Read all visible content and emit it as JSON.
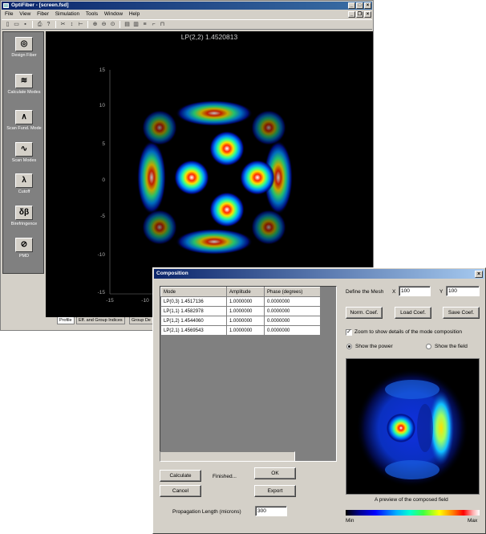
{
  "main_window": {
    "title": "OptiFiber - [screen.fsd]",
    "menu": [
      "File",
      "View",
      "Fiber",
      "Simulation",
      "Tools",
      "Window",
      "Help"
    ],
    "sidebar": [
      {
        "label": "Design Fiber",
        "icon": "design-fiber-icon",
        "glyph": "◎"
      },
      {
        "label": "Calculate Modes",
        "icon": "calculate-modes-icon",
        "glyph": "≋"
      },
      {
        "label": "Scan Fund. Mode",
        "icon": "scan-fund-mode-icon",
        "glyph": "∧"
      },
      {
        "label": "Scan Modes",
        "icon": "scan-modes-icon",
        "glyph": "∿"
      },
      {
        "label": "Cutoff",
        "icon": "cutoff-icon",
        "glyph": "λ"
      },
      {
        "label": "Birefringence",
        "icon": "birefringence-icon",
        "glyph": "δβ"
      },
      {
        "label": "PMD",
        "icon": "pmd-icon",
        "glyph": "⊘"
      }
    ],
    "plot": {
      "title": "LP(2,2)  1.4520813",
      "y_ticks": [
        "15",
        "10",
        "5",
        "0",
        "-5",
        "-10",
        "-15"
      ],
      "x_ticks": [
        "-15",
        "-10"
      ]
    },
    "tabs": [
      "Profile",
      "Eff. and Group Indices",
      "Group De"
    ]
  },
  "composition_dialog": {
    "title": "Composition",
    "close_glyph": "×",
    "table": {
      "headers": [
        "Mode",
        "Amplitude",
        "Phase (degrees)"
      ],
      "rows": [
        [
          "LP(0,3)  1.4517136",
          "1.0000000",
          "0.0000000"
        ],
        [
          "LP(1,1)  1.4582978",
          "1.0000000",
          "0.0000000"
        ],
        [
          "LP(1,2)  1.4544060",
          "1.0000000",
          "0.0000000"
        ],
        [
          "LP(2,1)  1.4569543",
          "1.0000000",
          "0.0000000"
        ]
      ]
    },
    "mesh": {
      "label": "Define the Mesh",
      "x_label": "X",
      "x_value": "100",
      "y_label": "Y",
      "y_value": "100"
    },
    "buttons": {
      "norm": "Norm. Coef.",
      "load": "Load Coef.",
      "save": "Save Coef.",
      "calculate": "Calculate",
      "cancel": "Cancel",
      "ok": "OK",
      "export": "Export"
    },
    "zoom_checkbox": {
      "label": "Zoom to show details of the mode composition",
      "checked": true
    },
    "radio": {
      "power": "Show the power",
      "field": "Show the field",
      "selected": "power"
    },
    "status": "Finished...",
    "propagation": {
      "label": "Propagation Length (microns)",
      "value": "300"
    },
    "preview_caption": "A preview of the composed field",
    "colorbar": {
      "min": "Min",
      "max": "Max"
    }
  }
}
